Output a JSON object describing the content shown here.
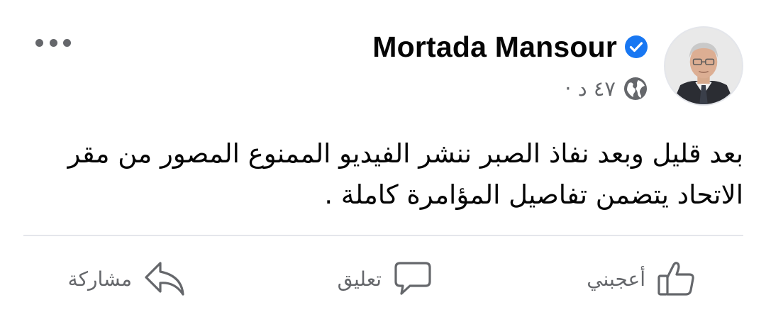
{
  "post": {
    "author": {
      "name": "Mortada Mansour",
      "verified": true,
      "avatar_icon": "profile-photo"
    },
    "meta": {
      "time": "٤٧ د ·",
      "audience_icon": "globe-icon"
    },
    "more_icon": "more-options-icon",
    "text": "بعد قليل وبعد نفاذ الصبر ننشر الفيديو الممنوع المصور من مقر الاتحاد يتضمن تفاصيل المؤامرة كاملة ."
  },
  "actions": {
    "like_label": "أعجبني",
    "comment_label": "تعليق",
    "share_label": "مشاركة"
  },
  "colors": {
    "verified_blue": "#1877f2",
    "secondary_text": "#65676b",
    "primary_text": "#050505",
    "divider": "#e4e6eb"
  }
}
